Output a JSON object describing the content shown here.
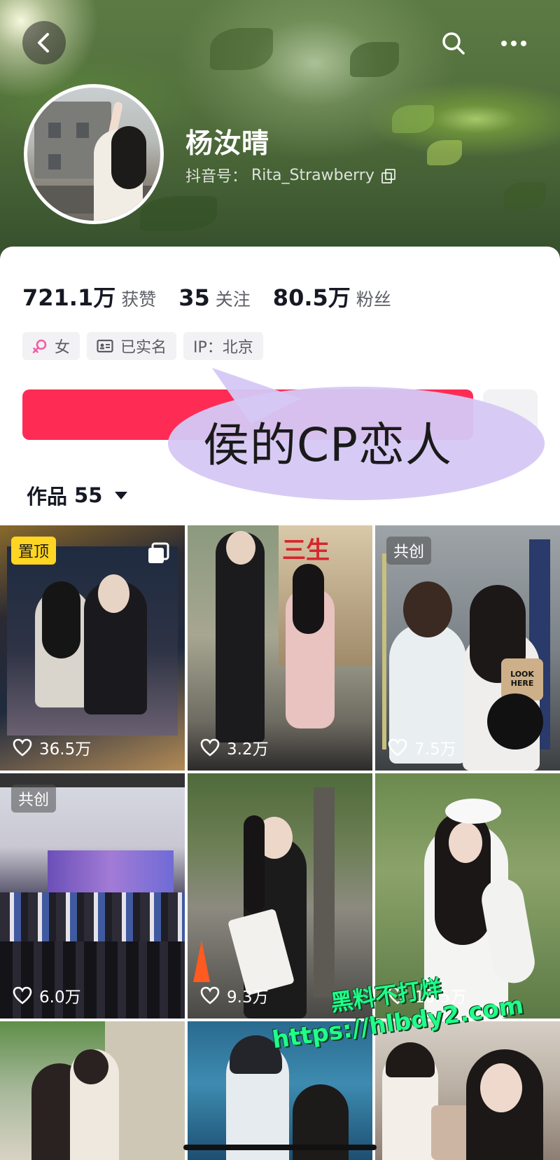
{
  "header": {
    "name": "杨汝晴",
    "douyin_id_label": "抖音号：",
    "douyin_id": "Rita_Strawberry",
    "back_icon": "chevron-left-icon",
    "search_icon": "search-icon",
    "more_icon": "more-dots-icon"
  },
  "stats": [
    {
      "value": "721.1万",
      "label": "获赞"
    },
    {
      "value": "35",
      "label": "关注"
    },
    {
      "value": "80.5万",
      "label": "粉丝"
    }
  ],
  "tags": [
    {
      "icon": "female-icon",
      "label": "女"
    },
    {
      "icon": "id-card-icon",
      "label": "已实名"
    },
    {
      "icon": "",
      "label": "IP：北京"
    }
  ],
  "follow_button": {
    "label": "关注",
    "color": "#fe2c55"
  },
  "overlay_caption": "侯的CP恋人",
  "works_tab": {
    "label": "作品",
    "count": "55"
  },
  "videos": [
    {
      "likes": "36.5万",
      "badge": "置顶"
    },
    {
      "likes": "3.2万",
      "badge": ""
    },
    {
      "likes": "7.5万",
      "badge": "共创"
    },
    {
      "likes": "6.0万",
      "badge": "共创"
    },
    {
      "likes": "9.3万",
      "badge": ""
    },
    {
      "likes": "10.5万",
      "badge": ""
    },
    {
      "likes": "",
      "badge": ""
    },
    {
      "likes": "",
      "badge": ""
    },
    {
      "likes": "",
      "badge": ""
    }
  ],
  "video_text": {
    "poster_title": "三生",
    "look_here": "LOOK HERE"
  },
  "watermark": {
    "line1": "黑料不打烊",
    "line2": "https://hlbdy2.com"
  },
  "colors": {
    "accent_red": "#fe2c55",
    "pinned_badge": "#ffd523",
    "bubble_purple": "#d5c8f6",
    "watermark_green": "#1fff8a"
  }
}
